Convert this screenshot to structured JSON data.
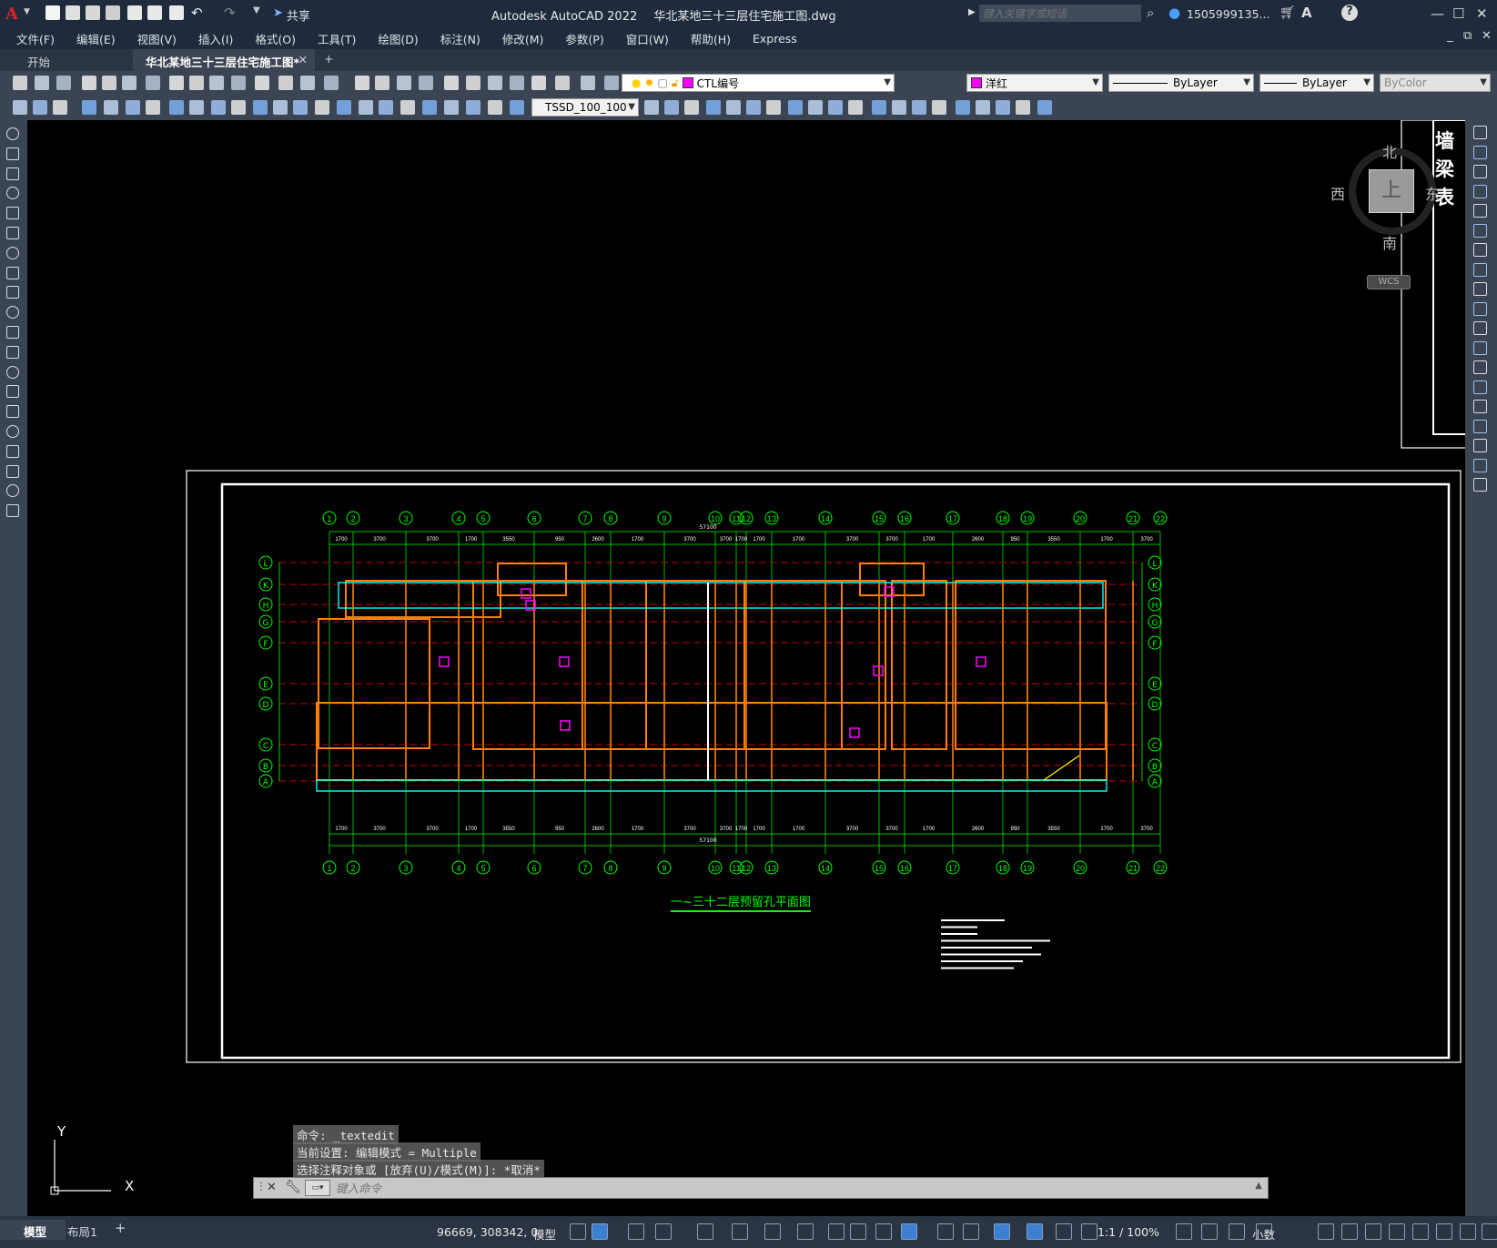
{
  "titlebar": {
    "app_title": "Autodesk AutoCAD 2022",
    "file_title": "华北某地三十三层住宅施工图.dwg",
    "share_label": "共享",
    "search_placeholder": "键入关键字或短语",
    "user_name": "1505999135..."
  },
  "menu": [
    "文件(F)",
    "编辑(E)",
    "视图(V)",
    "插入(I)",
    "格式(O)",
    "工具(T)",
    "绘图(D)",
    "标注(N)",
    "修改(M)",
    "参数(P)",
    "窗口(W)",
    "帮助(H)",
    "Express"
  ],
  "tabs": {
    "start": "开始",
    "active_doc": "华北某地三十三层住宅施工图*",
    "close": "✕",
    "add": "+"
  },
  "toolbar": {
    "layer_name": "CTL编号",
    "color_name": "洋红",
    "color_swatch": "#ff00ff",
    "linetype": "ByLayer",
    "lineweight": "ByLayer",
    "plotstyle": "ByColor",
    "dim_style": "TSSD_100_100"
  },
  "viewcube": {
    "north": "北",
    "south": "南",
    "west": "西",
    "east": "东",
    "top": "上",
    "wcs": "WCS"
  },
  "sidelabel": [
    "墙",
    "梁",
    "表"
  ],
  "drawing": {
    "title": "一~三十二层预留孔平面图",
    "top_axes": [
      "1",
      "2",
      "3",
      "4",
      "5",
      "6",
      "7",
      "8",
      "9",
      "10",
      "11",
      "12",
      "13",
      "14",
      "15",
      "16",
      "17",
      "18",
      "19",
      "20",
      "21",
      "22"
    ],
    "row_axes": [
      "L",
      "K",
      "H",
      "G",
      "F",
      "E",
      "D",
      "C",
      "B",
      "A"
    ],
    "total_dim": "57100",
    "dims": [
      "1700",
      "3700",
      "3700",
      "1700",
      "3550",
      "950",
      "2600",
      "1700",
      "3700",
      "3700",
      "1700",
      "1700",
      "1700",
      "3700",
      "3700",
      "1700",
      "2600",
      "950",
      "3550",
      "1700",
      "3700",
      "3700",
      "1700"
    ]
  },
  "ucs": {
    "x": "X",
    "y": "Y"
  },
  "command": {
    "history": [
      "命令: _textedit",
      "当前设置: 编辑模式 = Multiple",
      "选择注释对象或 [放弃(U)/模式(M)]: *取消*"
    ],
    "placeholder": "键入命令"
  },
  "status": {
    "coords": "96669, 308342, 0",
    "model_label": "模型",
    "model_tab": "模型",
    "layout_tab": "布局1",
    "scale": "1:1 / 100%",
    "units": "小数"
  },
  "colors": {
    "green": "#00ff00",
    "red": "#ff0000",
    "orange": "#ff8000",
    "cyan": "#00ffff",
    "magenta": "#ff00ff",
    "title_bg": "#1f2b3c"
  }
}
